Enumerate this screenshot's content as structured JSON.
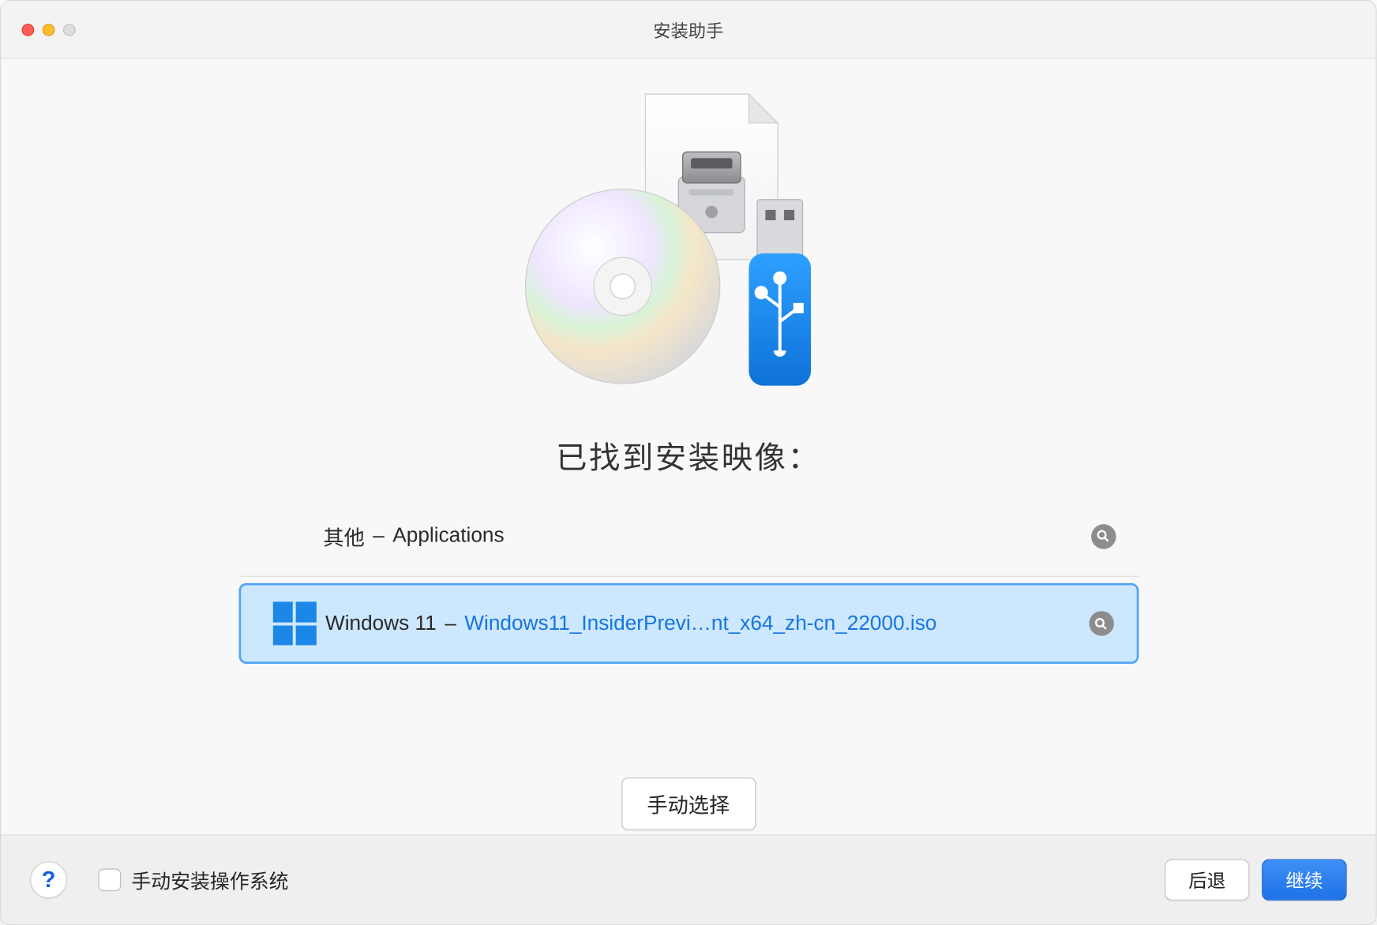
{
  "window": {
    "title": "安装助手"
  },
  "headline": "已找到安装映像：",
  "rows": [
    {
      "primary": "其他",
      "secondary": "Applications"
    },
    {
      "primary": "Windows 11",
      "secondary": "Windows11_InsiderPrevi…nt_x64_zh-cn_22000.iso"
    }
  ],
  "manual_button": "手动选择",
  "footer": {
    "checkbox_label": "手动安装操作系统",
    "back": "后退",
    "continue": "继续"
  }
}
